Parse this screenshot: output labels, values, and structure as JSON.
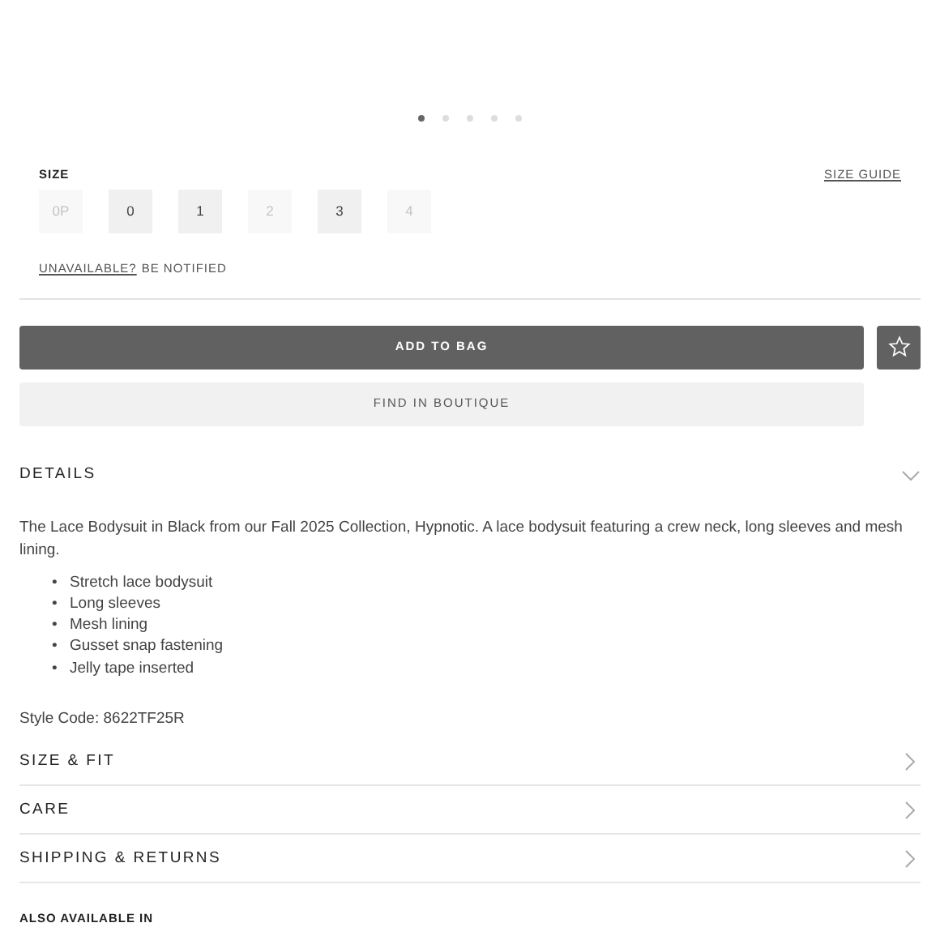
{
  "carousel": {
    "dots": [
      {
        "selected": true
      },
      {
        "selected": false
      },
      {
        "selected": false
      },
      {
        "selected": false
      },
      {
        "selected": false
      }
    ]
  },
  "size": {
    "label": "SIZE",
    "guide": "SIZE GUIDE",
    "options": [
      {
        "label": "0P",
        "disabled": true
      },
      {
        "label": "0",
        "disabled": false
      },
      {
        "label": "1",
        "disabled": false
      },
      {
        "label": "2",
        "disabled": true
      },
      {
        "label": "3",
        "disabled": false
      },
      {
        "label": "4",
        "disabled": true
      }
    ],
    "notify_link": "UNAVAILABLE?",
    "notify_text": "BE NOTIFIED"
  },
  "buttons": {
    "add": "ADD TO BAG",
    "find": "FIND IN BOUTIQUE"
  },
  "sections": [
    {
      "title": "DETAILS",
      "expanded": true,
      "description": "The Lace Bodysuit in Black from our Fall 2025 Collection, Hypnotic. A lace bodysuit featuring a crew neck, long sleeves and mesh lining.",
      "bullets": [
        {
          "marker": "•",
          "text": "Stretch lace bodysuit"
        },
        {
          "marker": "•",
          "text": "Long sleeves"
        },
        {
          "marker": "•",
          "text": "Mesh lining"
        },
        {
          "marker": "•",
          "text": "Gusset snap fastening"
        },
        {
          "marker": "•",
          "text": "Jelly tape inserted"
        }
      ],
      "style_code": "Style Code: 8622TF25R"
    },
    {
      "title": "SIZE & FIT",
      "expanded": false
    },
    {
      "title": "CARE",
      "expanded": false
    },
    {
      "title": "SHIPPING & RETURNS",
      "expanded": false
    }
  ],
  "also_available": "ALSO AVAILABLE IN"
}
